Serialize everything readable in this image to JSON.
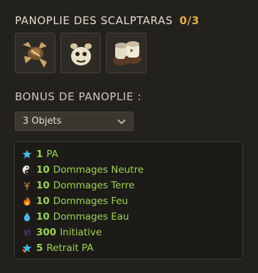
{
  "panoplie": {
    "title": "PANOPLIE DES SCALPTARAS",
    "count": "0/3",
    "items": [
      {
        "icon": "claw-amulet-icon"
      },
      {
        "icon": "scalptara-belt-icon"
      },
      {
        "icon": "scalptara-boots-icon"
      }
    ]
  },
  "bonus": {
    "title": "BONUS DE PANOPLIE :",
    "selected": "3 Objets",
    "chevron_icon": "chevron-down-icon",
    "rows": [
      {
        "icon": "star-pa-icon",
        "value": "1",
        "label": "PA",
        "icon_color": "#4cb6e8"
      },
      {
        "icon": "neutral-yinyang-icon",
        "value": "10",
        "label": "Dommages Neutre",
        "icon_color": "#e8e4da"
      },
      {
        "icon": "earth-tree-icon",
        "value": "10",
        "label": "Dommages Terre",
        "icon_color": "#b07a3a"
      },
      {
        "icon": "fire-icon",
        "value": "10",
        "label": "Dommages Feu",
        "icon_color": "#f07a1e"
      },
      {
        "icon": "water-drop-icon",
        "value": "10",
        "label": "Dommages Eau",
        "icon_color": "#4fb4e6"
      },
      {
        "icon": "initiative-icon",
        "value": "300",
        "label": "Initiative",
        "icon_color": "#9b4fd0"
      },
      {
        "icon": "retrait-pa-icon",
        "value": "5",
        "label": "Retrait PA",
        "icon_color": "#4cb6e8"
      }
    ]
  },
  "colors": {
    "accent": "#e0b146",
    "bonus_text": "#9fd35a",
    "background": "#23211d"
  }
}
